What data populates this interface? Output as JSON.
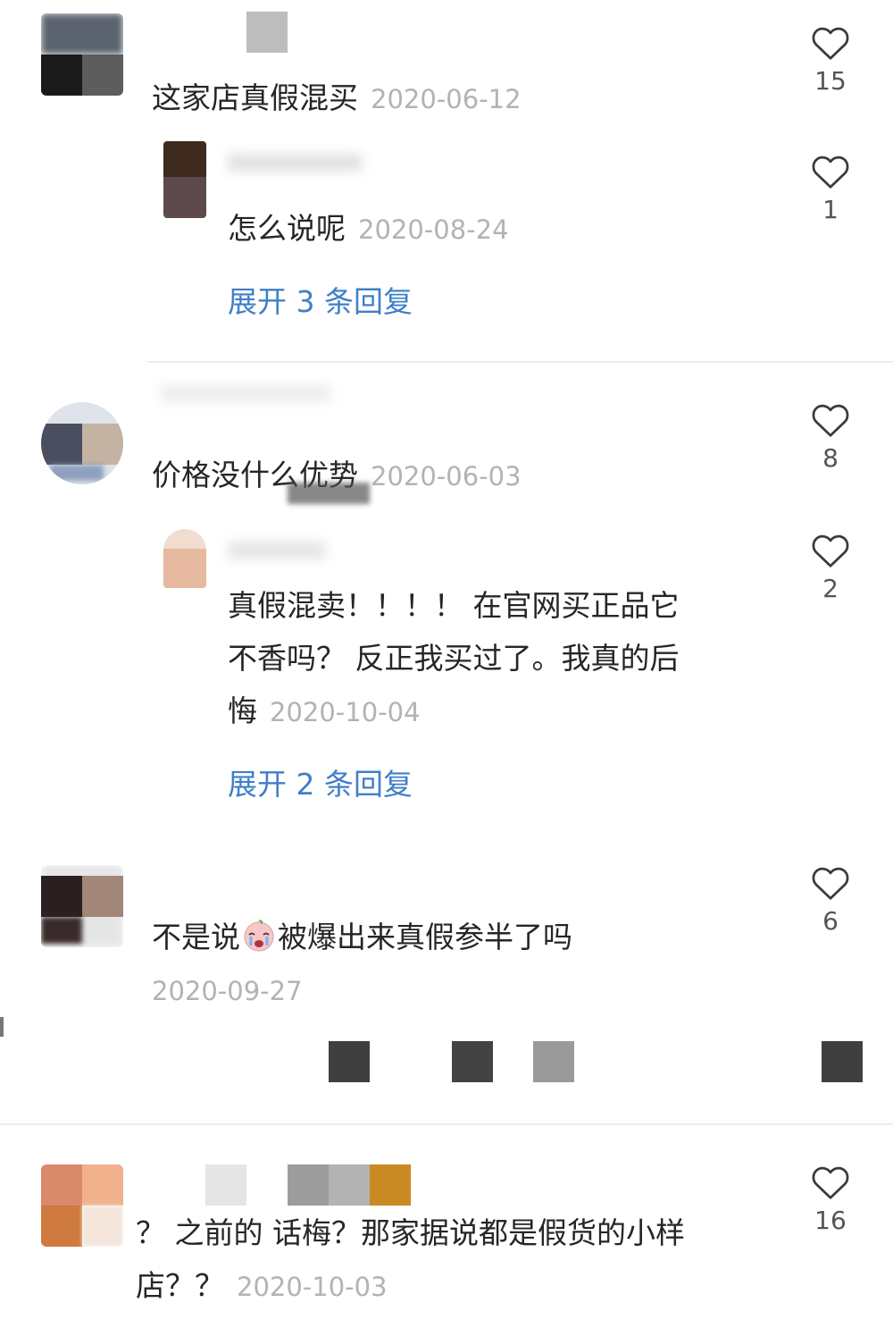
{
  "comments": [
    {
      "text": "这家店真假混买",
      "date": "2020-06-12",
      "likes": "15",
      "reply": {
        "text": "怎么说呢",
        "date": "2020-08-24",
        "likes": "1"
      },
      "expand_label": "展开 3 条回复"
    },
    {
      "text": "价格没什么优势",
      "date": "2020-06-03",
      "likes": "8",
      "reply": {
        "text_lines": [
          "真假混卖！！！！ 在官网买正品它",
          "不香吗？ 反正我买过了。我真的后",
          "悔"
        ],
        "date": "2020-10-04",
        "likes": "2"
      },
      "expand_label": "展开 2 条回复"
    },
    {
      "text_before_emoji": "不是说",
      "emoji": "crying-face-emoji",
      "text_after_emoji": "被爆出来真假参半了吗",
      "date": "2020-09-27",
      "likes": "6"
    },
    {
      "text_lines": [
        "？ 之前的 话梅？那家据说都是假货的小样",
        "店？？"
      ],
      "date": "2020-10-03",
      "likes": "16"
    }
  ],
  "colors": {
    "link": "#3f7fc8",
    "date": "#b3b3b3",
    "divider": "#ececec"
  },
  "icons": {
    "like": "heart-outline-icon"
  }
}
